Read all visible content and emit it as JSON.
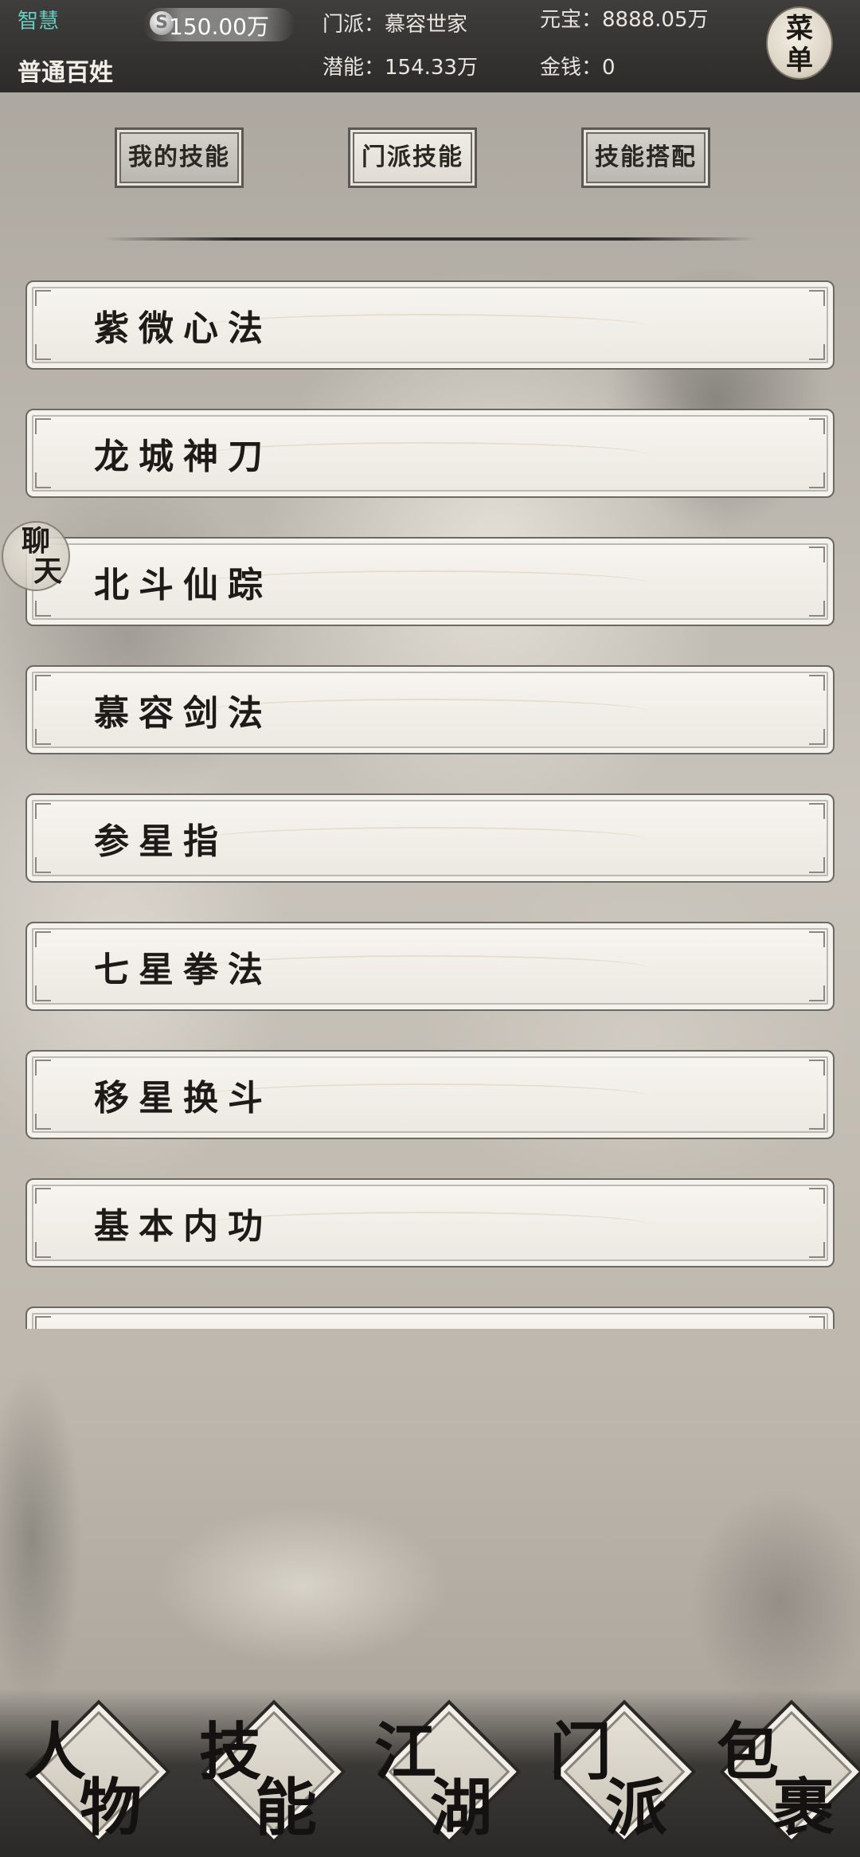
{
  "header": {
    "wisdom_label": "智慧",
    "rank": "普通百姓",
    "silver_icon": "S",
    "silver_value": "150.00万",
    "sect": "门派：慕容世家",
    "potential": "潜能：154.33万",
    "yuanbao": "元宝：8888.05万",
    "money": "金钱：0",
    "menu_line1": "菜",
    "menu_line2": "单"
  },
  "tabs": [
    {
      "label": "我的技能",
      "active": false
    },
    {
      "label": "门派技能",
      "active": true
    },
    {
      "label": "技能搭配",
      "active": false
    }
  ],
  "skills": [
    "紫微心法",
    "龙城神刀",
    "北斗仙踪",
    "慕容剑法",
    "参星指",
    "七星拳法",
    "移星换斗",
    "基本内功",
    ""
  ],
  "chat": {
    "line1": "聊",
    "line2": "天"
  },
  "bottom_nav": [
    {
      "c1": "人",
      "c2": "物"
    },
    {
      "c1": "技",
      "c2": "能"
    },
    {
      "c1": "江",
      "c2": "湖"
    },
    {
      "c1": "门",
      "c2": "派"
    },
    {
      "c1": "包",
      "c2": "裹"
    }
  ]
}
